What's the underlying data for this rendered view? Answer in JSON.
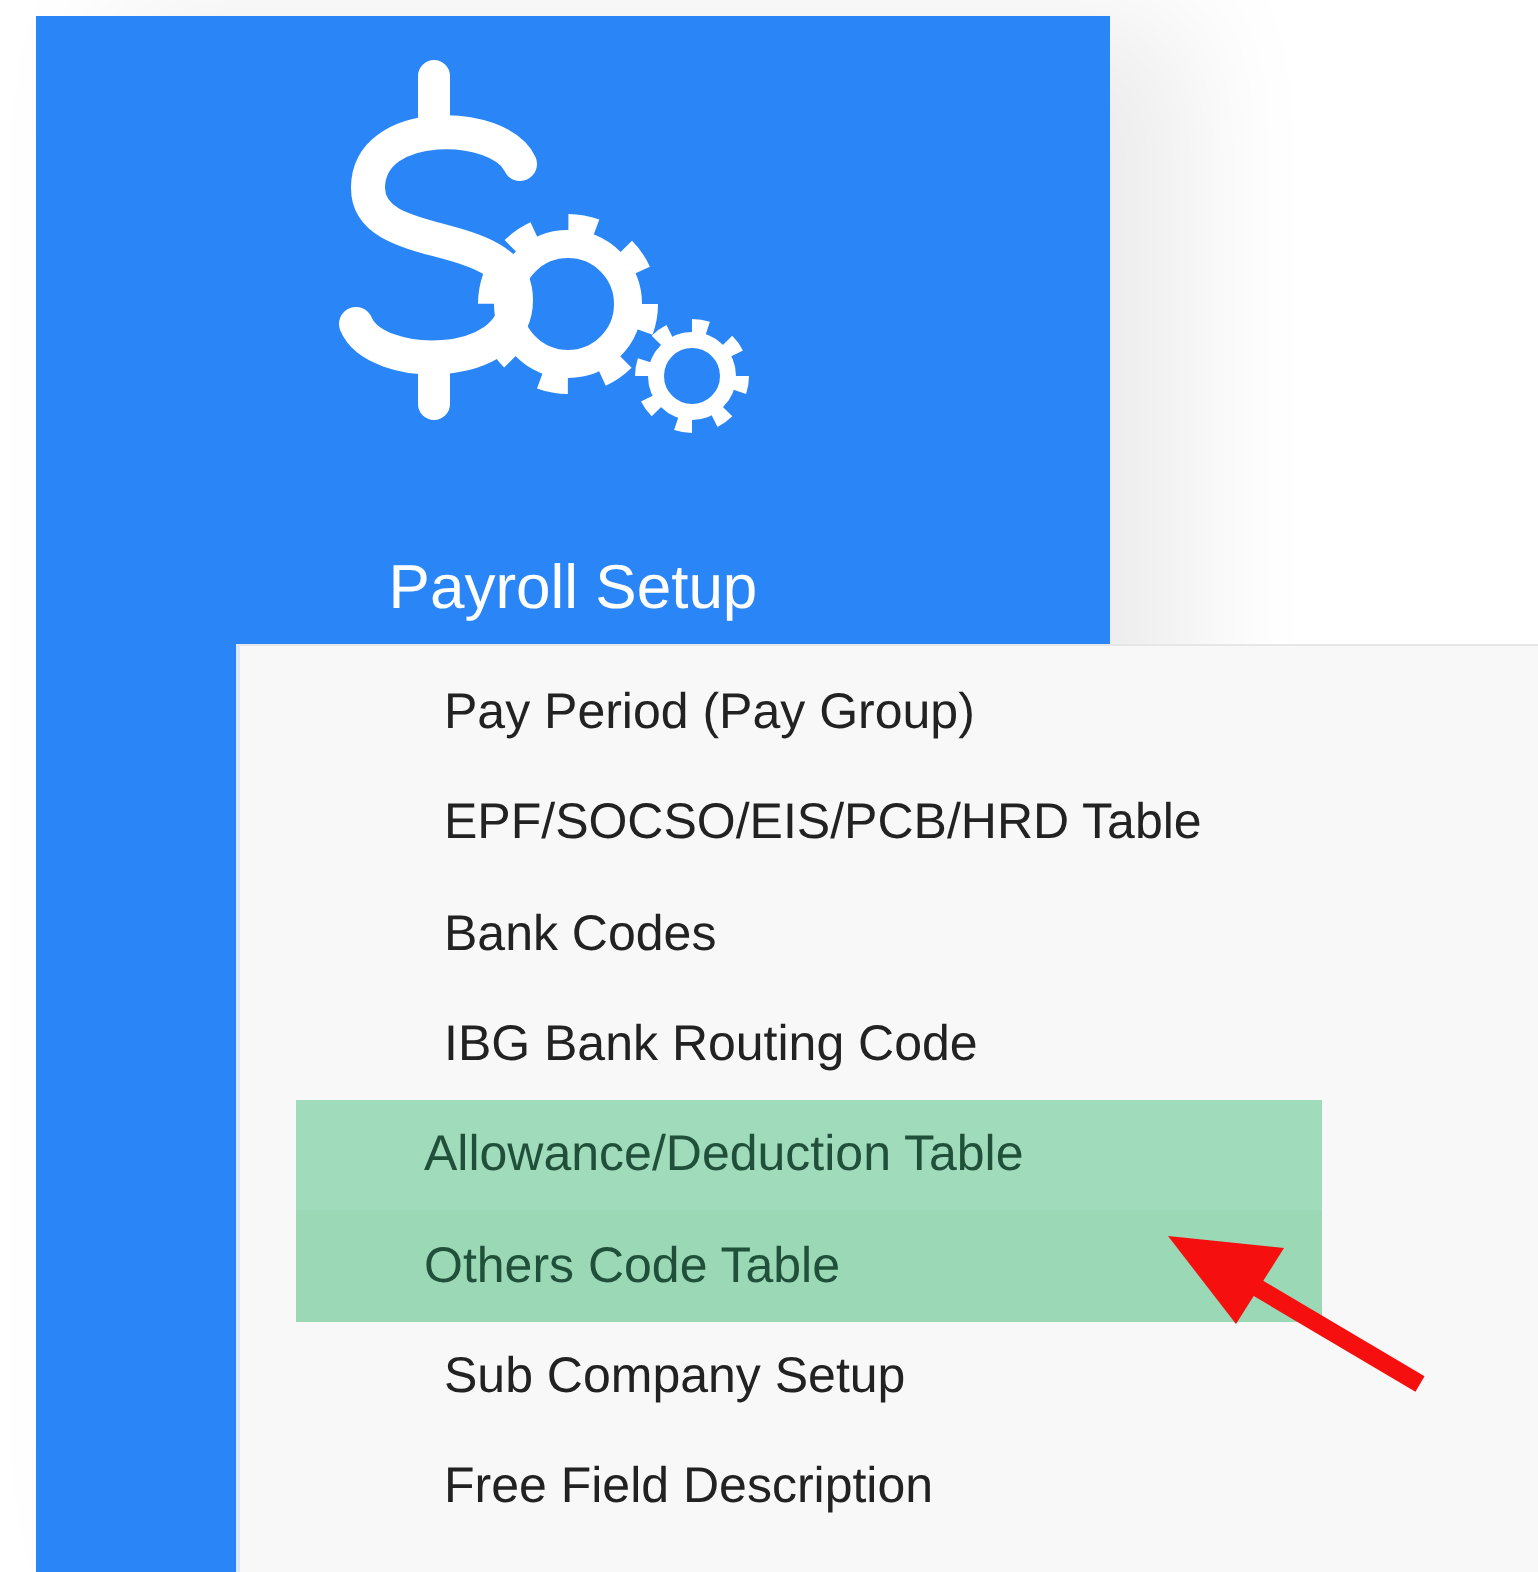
{
  "tile": {
    "label": "Payroll Setup"
  },
  "menu": {
    "items": [
      {
        "label": "Pay Period (Pay Group)",
        "hovered": false,
        "highlighted": false
      },
      {
        "label": "EPF/SOCSO/EIS/PCB/HRD Table",
        "hovered": false,
        "highlighted": false
      },
      {
        "label": "Bank Codes",
        "hovered": false,
        "highlighted": false
      },
      {
        "label": "IBG Bank Routing Code",
        "hovered": false,
        "highlighted": false
      },
      {
        "label": "Allowance/Deduction Table",
        "hovered": false,
        "highlighted": true
      },
      {
        "label": "Others Code Table",
        "hovered": true,
        "highlighted": true
      },
      {
        "label": "Sub Company Setup",
        "hovered": false,
        "highlighted": false
      },
      {
        "label": "Free Field Description",
        "hovered": false,
        "highlighted": false
      }
    ]
  }
}
